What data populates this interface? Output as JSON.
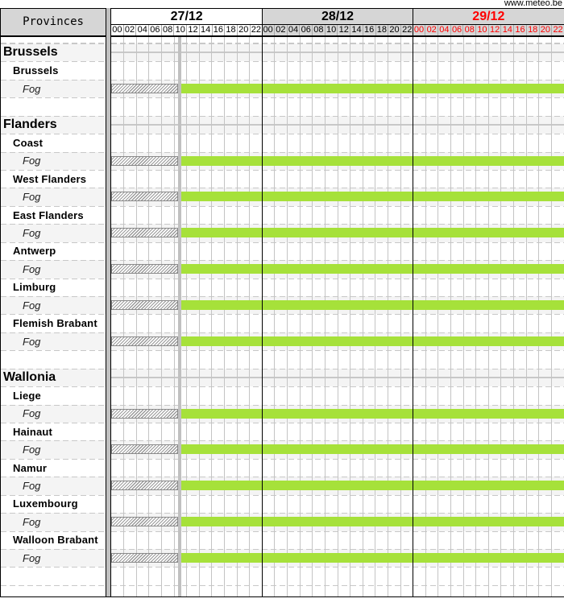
{
  "credit": "www.meteo.be",
  "left_header": "Provinces",
  "colors": {
    "header_gray": "#d6d6d6",
    "shaded_row": "#f4f4f4",
    "weekend_red": "#ff0000",
    "forecast_green": "#a6e13a",
    "now_marker": "#c0c0c0"
  },
  "timeline": {
    "hours_total": 72,
    "step_hours": 2,
    "now_hour": 10.9
  },
  "days": [
    {
      "label": "27/12",
      "style": "current",
      "color": "#000000",
      "hours": [
        "00",
        "02",
        "04",
        "06",
        "08",
        "10",
        "12",
        "14",
        "16",
        "18",
        "20",
        "22"
      ]
    },
    {
      "label": "28/12",
      "style": "future",
      "color": "#000000",
      "hours": [
        "00",
        "02",
        "04",
        "06",
        "08",
        "10",
        "12",
        "14",
        "16",
        "18",
        "20",
        "22"
      ]
    },
    {
      "label": "29/12",
      "style": "future",
      "color": "#ff0000",
      "hours": [
        "00",
        "02",
        "04",
        "06",
        "08",
        "10",
        "12",
        "14",
        "16",
        "18",
        "20",
        "22"
      ]
    }
  ],
  "rows": [
    {
      "type": "region",
      "label": "Brussels"
    },
    {
      "type": "province",
      "label": "Brussels"
    },
    {
      "type": "hazard",
      "label": "Fog",
      "bars": [
        {
          "kind": "past",
          "from_hour": 0,
          "to_hour": 10.9
        },
        {
          "kind": "forecast",
          "from_hour": 10.9,
          "to_hour": 72,
          "color": "#a6e13a"
        }
      ]
    },
    {
      "type": "blank"
    },
    {
      "type": "region",
      "label": "Flanders"
    },
    {
      "type": "province",
      "label": "Coast"
    },
    {
      "type": "hazard",
      "label": "Fog",
      "bars": [
        {
          "kind": "past",
          "from_hour": 0,
          "to_hour": 10.9
        },
        {
          "kind": "forecast",
          "from_hour": 10.9,
          "to_hour": 72,
          "color": "#a6e13a"
        }
      ]
    },
    {
      "type": "province",
      "label": "West Flanders"
    },
    {
      "type": "hazard",
      "label": "Fog",
      "bars": [
        {
          "kind": "past",
          "from_hour": 0,
          "to_hour": 10.9
        },
        {
          "kind": "forecast",
          "from_hour": 10.9,
          "to_hour": 72,
          "color": "#a6e13a"
        }
      ]
    },
    {
      "type": "province",
      "label": "East Flanders"
    },
    {
      "type": "hazard",
      "label": "Fog",
      "bars": [
        {
          "kind": "past",
          "from_hour": 0,
          "to_hour": 10.9
        },
        {
          "kind": "forecast",
          "from_hour": 10.9,
          "to_hour": 72,
          "color": "#a6e13a"
        }
      ]
    },
    {
      "type": "province",
      "label": "Antwerp"
    },
    {
      "type": "hazard",
      "label": "Fog",
      "bars": [
        {
          "kind": "past",
          "from_hour": 0,
          "to_hour": 10.9
        },
        {
          "kind": "forecast",
          "from_hour": 10.9,
          "to_hour": 72,
          "color": "#a6e13a"
        }
      ]
    },
    {
      "type": "province",
      "label": "Limburg"
    },
    {
      "type": "hazard",
      "label": "Fog",
      "bars": [
        {
          "kind": "past",
          "from_hour": 0,
          "to_hour": 10.9
        },
        {
          "kind": "forecast",
          "from_hour": 10.9,
          "to_hour": 72,
          "color": "#a6e13a"
        }
      ]
    },
    {
      "type": "province",
      "label": "Flemish Brabant"
    },
    {
      "type": "hazard",
      "label": "Fog",
      "bars": [
        {
          "kind": "past",
          "from_hour": 0,
          "to_hour": 10.9
        },
        {
          "kind": "forecast",
          "from_hour": 10.9,
          "to_hour": 72,
          "color": "#a6e13a"
        }
      ]
    },
    {
      "type": "blank"
    },
    {
      "type": "region",
      "label": "Wallonia"
    },
    {
      "type": "province",
      "label": "Liege"
    },
    {
      "type": "hazard",
      "label": "Fog",
      "bars": [
        {
          "kind": "past",
          "from_hour": 0,
          "to_hour": 10.9
        },
        {
          "kind": "forecast",
          "from_hour": 10.9,
          "to_hour": 72,
          "color": "#a6e13a"
        }
      ]
    },
    {
      "type": "province",
      "label": "Hainaut"
    },
    {
      "type": "hazard",
      "label": "Fog",
      "bars": [
        {
          "kind": "past",
          "from_hour": 0,
          "to_hour": 10.9
        },
        {
          "kind": "forecast",
          "from_hour": 10.9,
          "to_hour": 72,
          "color": "#a6e13a"
        }
      ]
    },
    {
      "type": "province",
      "label": "Namur"
    },
    {
      "type": "hazard",
      "label": "Fog",
      "bars": [
        {
          "kind": "past",
          "from_hour": 0,
          "to_hour": 10.9
        },
        {
          "kind": "forecast",
          "from_hour": 10.9,
          "to_hour": 72,
          "color": "#a6e13a"
        }
      ]
    },
    {
      "type": "province",
      "label": "Luxembourg"
    },
    {
      "type": "hazard",
      "label": "Fog",
      "bars": [
        {
          "kind": "past",
          "from_hour": 0,
          "to_hour": 10.9
        },
        {
          "kind": "forecast",
          "from_hour": 10.9,
          "to_hour": 72,
          "color": "#a6e13a"
        }
      ]
    },
    {
      "type": "province",
      "label": "Walloon Brabant"
    },
    {
      "type": "hazard",
      "label": "Fog",
      "bars": [
        {
          "kind": "past",
          "from_hour": 0,
          "to_hour": 10.9
        },
        {
          "kind": "forecast",
          "from_hour": 10.9,
          "to_hour": 72,
          "color": "#a6e13a"
        }
      ]
    },
    {
      "type": "blank"
    },
    {
      "type": "blank"
    }
  ]
}
